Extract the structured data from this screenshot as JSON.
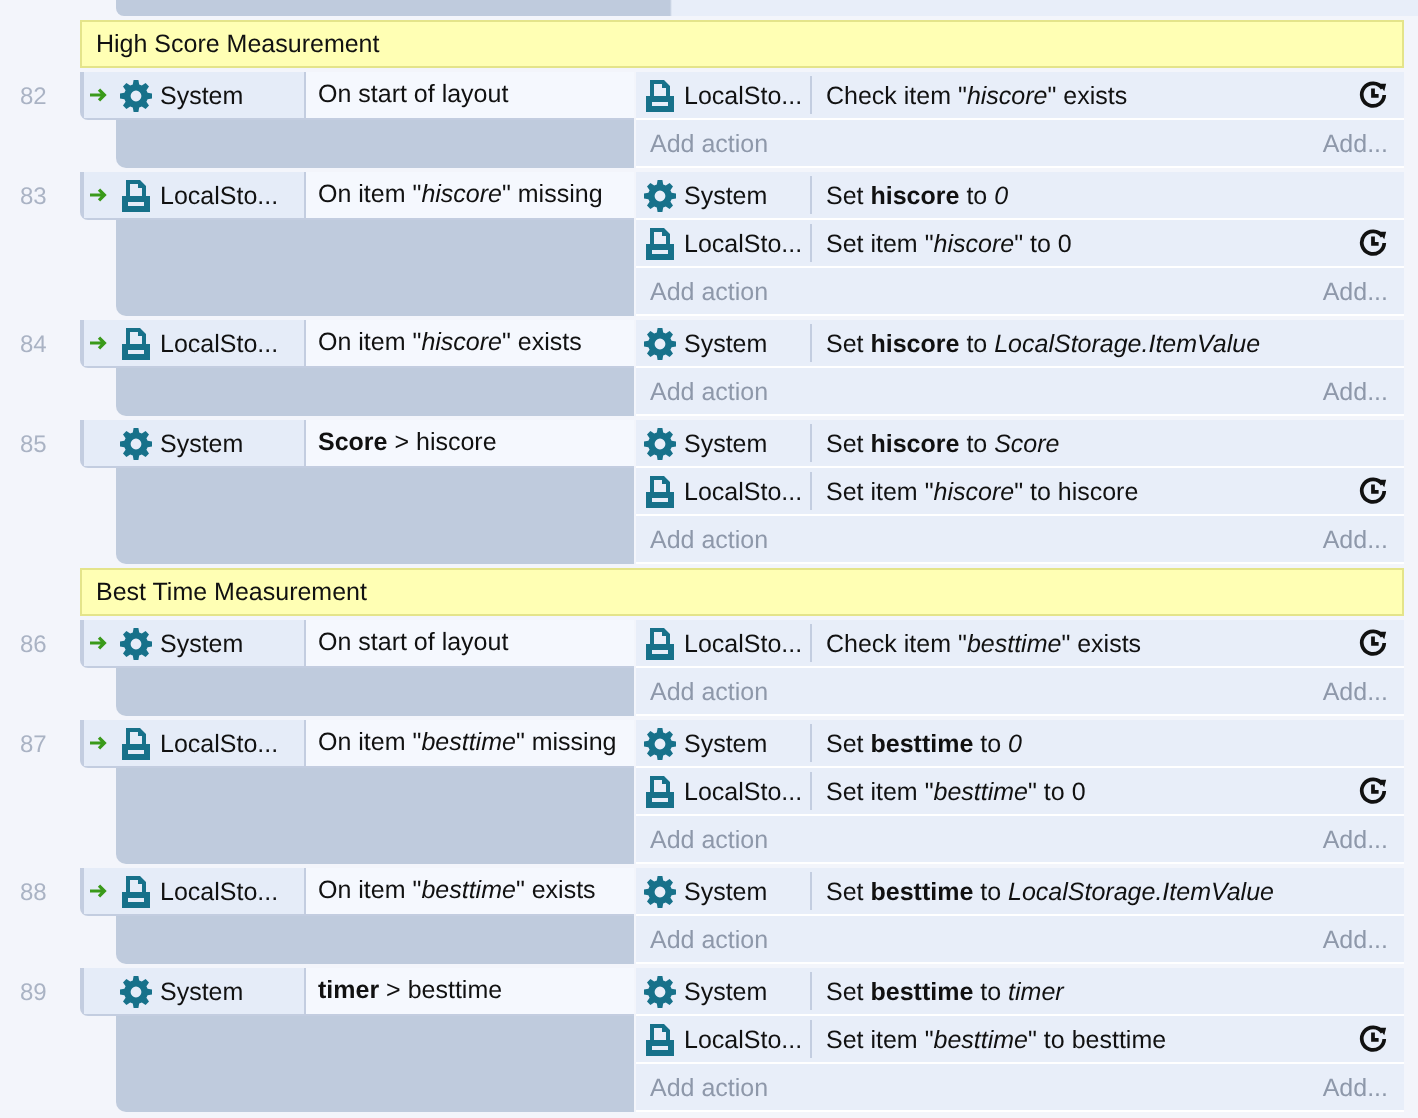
{
  "blocks": [
    {
      "kind": "group",
      "title": "High Score Measurement"
    },
    {
      "kind": "event",
      "number": "82",
      "trigger": true,
      "condition": {
        "object": "System",
        "kind": "system",
        "text": "On start of layout"
      },
      "actions": [
        {
          "object": "LocalSto...",
          "kind": "storage",
          "text": "Check item \"*hiscore*\" exists",
          "async": true
        }
      ],
      "add_action": "Add action",
      "add": "Add..."
    },
    {
      "kind": "event",
      "number": "83",
      "trigger": true,
      "condition": {
        "object": "LocalSto...",
        "kind": "storage",
        "text": "On item \"*hiscore*\" missing"
      },
      "actions": [
        {
          "object": "System",
          "kind": "system",
          "text": "Set **hiscore** to *0*",
          "async": false
        },
        {
          "object": "LocalSto...",
          "kind": "storage",
          "text": "Set item \"*hiscore*\" to 0",
          "async": true
        }
      ],
      "add_action": "Add action",
      "add": "Add..."
    },
    {
      "kind": "event",
      "number": "84",
      "trigger": true,
      "condition": {
        "object": "LocalSto...",
        "kind": "storage",
        "text": "On item \"*hiscore*\" exists"
      },
      "actions": [
        {
          "object": "System",
          "kind": "system",
          "text": "Set **hiscore** to *LocalStorage.ItemValue*",
          "async": false
        }
      ],
      "add_action": "Add action",
      "add": "Add..."
    },
    {
      "kind": "event",
      "number": "85",
      "trigger": false,
      "condition": {
        "object": "System",
        "kind": "system",
        "text": "**Score** > hiscore"
      },
      "actions": [
        {
          "object": "System",
          "kind": "system",
          "text": "Set **hiscore** to *Score*",
          "async": false
        },
        {
          "object": "LocalSto...",
          "kind": "storage",
          "text": "Set item \"*hiscore*\" to hiscore",
          "async": true
        }
      ],
      "add_action": "Add action",
      "add": "Add..."
    },
    {
      "kind": "group",
      "title": "Best Time Measurement"
    },
    {
      "kind": "event",
      "number": "86",
      "trigger": true,
      "condition": {
        "object": "System",
        "kind": "system",
        "text": "On start of layout"
      },
      "actions": [
        {
          "object": "LocalSto...",
          "kind": "storage",
          "text": "Check item \"*besttime*\" exists",
          "async": true
        }
      ],
      "add_action": "Add action",
      "add": "Add..."
    },
    {
      "kind": "event",
      "number": "87",
      "trigger": true,
      "condition": {
        "object": "LocalSto...",
        "kind": "storage",
        "text": "On item \"*besttime*\" missing"
      },
      "actions": [
        {
          "object": "System",
          "kind": "system",
          "text": "Set **besttime** to *0*",
          "async": false
        },
        {
          "object": "LocalSto...",
          "kind": "storage",
          "text": "Set item \"*besttime*\" to 0",
          "async": true
        }
      ],
      "add_action": "Add action",
      "add": "Add..."
    },
    {
      "kind": "event",
      "number": "88",
      "trigger": true,
      "condition": {
        "object": "LocalSto...",
        "kind": "storage",
        "text": "On item \"*besttime*\" exists"
      },
      "actions": [
        {
          "object": "System",
          "kind": "system",
          "text": "Set **besttime** to *LocalStorage.ItemValue*",
          "async": false
        }
      ],
      "add_action": "Add action",
      "add": "Add..."
    },
    {
      "kind": "event",
      "number": "89",
      "trigger": false,
      "condition": {
        "object": "System",
        "kind": "system",
        "text": "**timer** > besttime"
      },
      "actions": [
        {
          "object": "System",
          "kind": "system",
          "text": "Set **besttime** to *timer*",
          "async": false
        },
        {
          "object": "LocalSto...",
          "kind": "storage",
          "text": "Set item \"*besttime*\" to besttime",
          "async": true
        }
      ],
      "add_action": "Add action",
      "add": "Add..."
    }
  ]
}
